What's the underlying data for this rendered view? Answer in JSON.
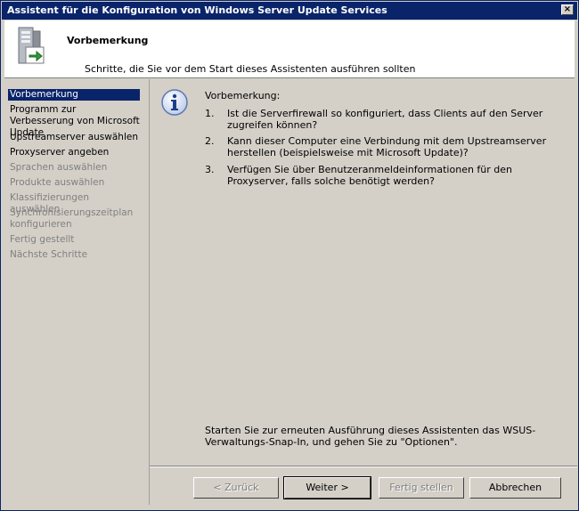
{
  "window": {
    "title": "Assistent für die Konfiguration von Windows Server Update Services",
    "close_label": "×"
  },
  "header": {
    "icon": "server-wizard-icon",
    "title": "Vorbemerkung",
    "subtitle": "Schritte, die Sie vor dem Start dieses Assistenten ausführen sollten"
  },
  "sidebar": {
    "items": [
      {
        "label": "Vorbemerkung",
        "state": "active"
      },
      {
        "label": "Programm zur Verbesserung von Microsoft Update",
        "state": "enabled"
      },
      {
        "label": "Upstreamserver auswählen",
        "state": "enabled"
      },
      {
        "label": "Proxyserver angeben",
        "state": "enabled"
      },
      {
        "label": "Sprachen auswählen",
        "state": "disabled"
      },
      {
        "label": "Produkte auswählen",
        "state": "disabled"
      },
      {
        "label": "Klassifizierungen auswählen",
        "state": "disabled"
      },
      {
        "label": "Synchronisierungszeitplan konfigurieren",
        "state": "disabled"
      },
      {
        "label": "Fertig gestellt",
        "state": "disabled"
      },
      {
        "label": "Nächste Schritte",
        "state": "disabled"
      }
    ]
  },
  "content": {
    "icon": "info-icon",
    "heading": "Vorbemerkung:",
    "items": [
      {
        "num": "1.",
        "text": "Ist die Serverfirewall so konfiguriert, dass Clients auf den Server zugreifen können?"
      },
      {
        "num": "2.",
        "text": "Kann dieser Computer eine Verbindung mit dem Upstreamserver herstellen (beispielsweise mit Microsoft Update)?"
      },
      {
        "num": "3.",
        "text": "Verfügen Sie über Benutzeranmeldeinformationen für den Proxyserver, falls solche benötigt werden?"
      }
    ],
    "bottom_text": "Starten Sie zur erneuten Ausführung dieses Assistenten das WSUS-Verwaltungs-Snap-In, und gehen Sie zu \"Optionen\"."
  },
  "buttons": {
    "back": "< Zurück",
    "next": "Weiter >",
    "finish": "Fertig stellen",
    "cancel": "Abbrechen"
  }
}
